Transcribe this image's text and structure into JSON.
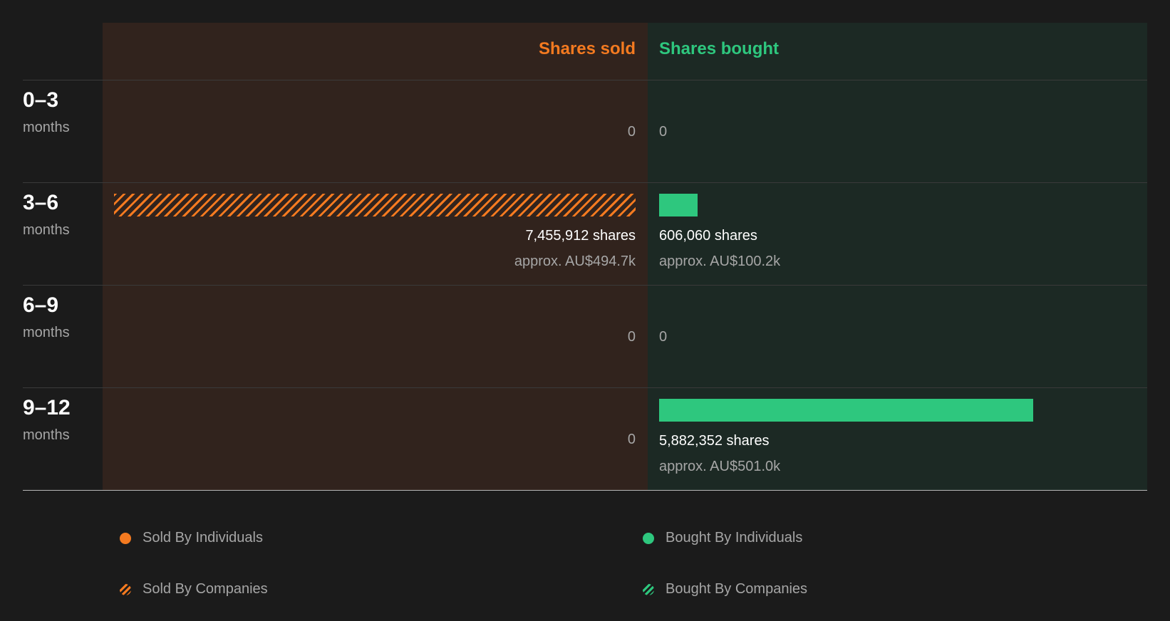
{
  "colors": {
    "sold": "#f47a20",
    "bought": "#2ec77e",
    "sold_bg": "#31231d",
    "bought_bg": "#1c2924",
    "page_bg": "#1b1b1b"
  },
  "chart_data": {
    "type": "bar",
    "orientation": "diverging-horizontal",
    "headers": {
      "sold": "Shares sold",
      "bought": "Shares bought"
    },
    "categories": [
      {
        "period": "0–3",
        "unit": "months"
      },
      {
        "period": "3–6",
        "unit": "months"
      },
      {
        "period": "6–9",
        "unit": "months"
      },
      {
        "period": "9–12",
        "unit": "months"
      }
    ],
    "series": [
      {
        "name": "Sold By Companies",
        "side": "sold",
        "kind": "companies",
        "values": [
          0,
          7455912,
          0,
          0
        ]
      },
      {
        "name": "Bought By Individuals",
        "side": "bought",
        "kind": "individuals",
        "values": [
          0,
          606060,
          0,
          5882352
        ]
      }
    ],
    "labels": {
      "sold": [
        {
          "shares": "0",
          "approx": ""
        },
        {
          "shares": "7,455,912 shares",
          "approx": "approx. AU$494.7k"
        },
        {
          "shares": "0",
          "approx": ""
        },
        {
          "shares": "0",
          "approx": ""
        }
      ],
      "bought": [
        {
          "shares": "0",
          "approx": ""
        },
        {
          "shares": "606,060 shares",
          "approx": "approx. AU$100.2k"
        },
        {
          "shares": "0",
          "approx": ""
        },
        {
          "shares": "5,882,352 shares",
          "approx": "approx. AU$501.0k"
        }
      ]
    },
    "legend": [
      {
        "label": "Sold By Individuals",
        "swatch": "solid-orange"
      },
      {
        "label": "Bought By Individuals",
        "swatch": "solid-green"
      },
      {
        "label": "Sold By Companies",
        "swatch": "hatch-orange"
      },
      {
        "label": "Bought By Companies",
        "swatch": "hatch-green"
      }
    ],
    "legend_placement": "bottom"
  }
}
